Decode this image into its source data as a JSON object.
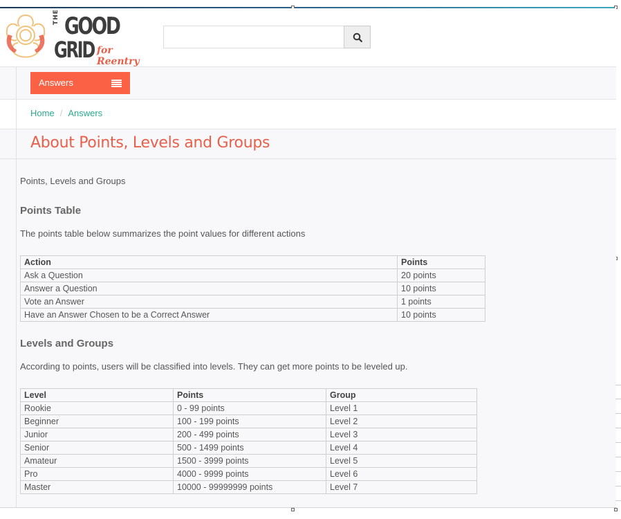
{
  "brand": {
    "line1": "THE",
    "word_good": "GOOD",
    "word_grid": "GRID",
    "tagline": "for Reentry",
    "colors": {
      "dark": "#3d3d3d",
      "accent": "#e8604a",
      "flower": "#f2c27b"
    }
  },
  "search": {
    "placeholder": "",
    "value": "",
    "icon": "search-icon"
  },
  "nav": {
    "answers_label": "Answers",
    "menu_icon": "hamburger-icon",
    "color": "#fb6145"
  },
  "breadcrumb": {
    "home": "Home",
    "separator": "/",
    "current": "Answers"
  },
  "page": {
    "title": "About Points, Levels and Groups",
    "intro": "Points, Levels and Groups"
  },
  "points_section": {
    "heading": "Points Table",
    "description": "The points table below summarizes the point values for different actions",
    "columns": [
      "Action",
      "Points"
    ],
    "rows": [
      [
        "Ask a Question",
        "20 points"
      ],
      [
        "Answer a Question",
        "10 points"
      ],
      [
        "Vote an Answer",
        "1 points"
      ],
      [
        "Have an Answer Chosen to be a Correct Answer",
        "10 points"
      ]
    ]
  },
  "levels_section": {
    "heading": "Levels and Groups",
    "description": "According to points, users will be classified into levels. They can get more points to be leveled up.",
    "columns": [
      "Level",
      "Points",
      "Group"
    ],
    "rows": [
      [
        "Rookie",
        "0 - 99 points",
        "Level 1"
      ],
      [
        "Beginner",
        "100 - 199 points",
        "Level 2"
      ],
      [
        "Junior",
        "200 - 499 points",
        "Level 3"
      ],
      [
        "Senior",
        "500 - 1499 points",
        "Level 4"
      ],
      [
        "Amateur",
        "1500 - 3999 points",
        "Level 5"
      ],
      [
        "Pro",
        "4000 - 9999 points",
        "Level 6"
      ],
      [
        "Master",
        "10000 - 99999999 points",
        "Level 7"
      ]
    ]
  }
}
